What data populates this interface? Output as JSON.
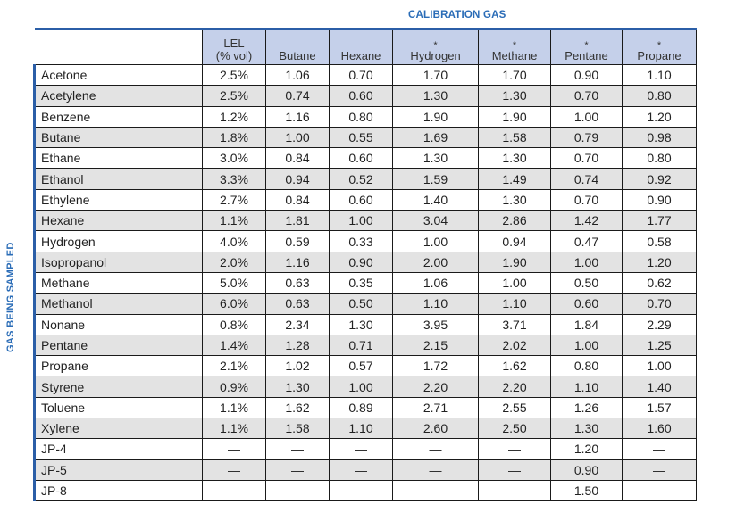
{
  "header": {
    "calibration_title": "CALIBRATION GAS",
    "side_title": "GAS BEING SAMPLED"
  },
  "columns": [
    {
      "marker": "",
      "label": "LEL",
      "sublabel": "(% vol)"
    },
    {
      "marker": "",
      "label": "Butane"
    },
    {
      "marker": "",
      "label": "Hexane"
    },
    {
      "marker": "*",
      "label": "Hydrogen"
    },
    {
      "marker": "*",
      "label": "Methane"
    },
    {
      "marker": "*",
      "label": "Pentane"
    },
    {
      "marker": "*",
      "label": "Propane"
    }
  ],
  "rows": [
    {
      "gas": "Acetone",
      "values": [
        "2.5%",
        "1.06",
        "0.70",
        "1.70",
        "1.70",
        "0.90",
        "1.10"
      ]
    },
    {
      "gas": "Acetylene",
      "values": [
        "2.5%",
        "0.74",
        "0.60",
        "1.30",
        "1.30",
        "0.70",
        "0.80"
      ]
    },
    {
      "gas": "Benzene",
      "values": [
        "1.2%",
        "1.16",
        "0.80",
        "1.90",
        "1.90",
        "1.00",
        "1.20"
      ]
    },
    {
      "gas": "Butane",
      "values": [
        "1.8%",
        "1.00",
        "0.55",
        "1.69",
        "1.58",
        "0.79",
        "0.98"
      ]
    },
    {
      "gas": "Ethane",
      "values": [
        "3.0%",
        "0.84",
        "0.60",
        "1.30",
        "1.30",
        "0.70",
        "0.80"
      ]
    },
    {
      "gas": "Ethanol",
      "values": [
        "3.3%",
        "0.94",
        "0.52",
        "1.59",
        "1.49",
        "0.74",
        "0.92"
      ]
    },
    {
      "gas": "Ethylene",
      "values": [
        "2.7%",
        "0.84",
        "0.60",
        "1.40",
        "1.30",
        "0.70",
        "0.90"
      ]
    },
    {
      "gas": "Hexane",
      "values": [
        "1.1%",
        "1.81",
        "1.00",
        "3.04",
        "2.86",
        "1.42",
        "1.77"
      ]
    },
    {
      "gas": "Hydrogen",
      "values": [
        "4.0%",
        "0.59",
        "0.33",
        "1.00",
        "0.94",
        "0.47",
        "0.58"
      ]
    },
    {
      "gas": "Isopropanol",
      "values": [
        "2.0%",
        "1.16",
        "0.90",
        "2.00",
        "1.90",
        "1.00",
        "1.20"
      ]
    },
    {
      "gas": "Methane",
      "values": [
        "5.0%",
        "0.63",
        "0.35",
        "1.06",
        "1.00",
        "0.50",
        "0.62"
      ]
    },
    {
      "gas": "Methanol",
      "values": [
        "6.0%",
        "0.63",
        "0.50",
        "1.10",
        "1.10",
        "0.60",
        "0.70"
      ]
    },
    {
      "gas": "Nonane",
      "values": [
        "0.8%",
        "2.34",
        "1.30",
        "3.95",
        "3.71",
        "1.84",
        "2.29"
      ]
    },
    {
      "gas": "Pentane",
      "values": [
        "1.4%",
        "1.28",
        "0.71",
        "2.15",
        "2.02",
        "1.00",
        "1.25"
      ]
    },
    {
      "gas": "Propane",
      "values": [
        "2.1%",
        "1.02",
        "0.57",
        "1.72",
        "1.62",
        "0.80",
        "1.00"
      ]
    },
    {
      "gas": "Styrene",
      "values": [
        "0.9%",
        "1.30",
        "1.00",
        "2.20",
        "2.20",
        "1.10",
        "1.40"
      ]
    },
    {
      "gas": "Toluene",
      "values": [
        "1.1%",
        "1.62",
        "0.89",
        "2.71",
        "2.55",
        "1.26",
        "1.57"
      ]
    },
    {
      "gas": "Xylene",
      "values": [
        "1.1%",
        "1.58",
        "1.10",
        "2.60",
        "2.50",
        "1.30",
        "1.60"
      ]
    },
    {
      "gas": "JP-4",
      "values": [
        "—",
        "—",
        "—",
        "—",
        "—",
        "1.20",
        "—"
      ]
    },
    {
      "gas": "JP-5",
      "values": [
        "—",
        "—",
        "—",
        "—",
        "—",
        "0.90",
        "—"
      ]
    },
    {
      "gas": "JP-8",
      "values": [
        "—",
        "—",
        "—",
        "—",
        "—",
        "1.50",
        "—"
      ]
    }
  ],
  "colors": {
    "accent_blue": "#2a6cb7",
    "header_fill": "#c5d0ea",
    "alt_row_fill": "#e3e3e3"
  }
}
